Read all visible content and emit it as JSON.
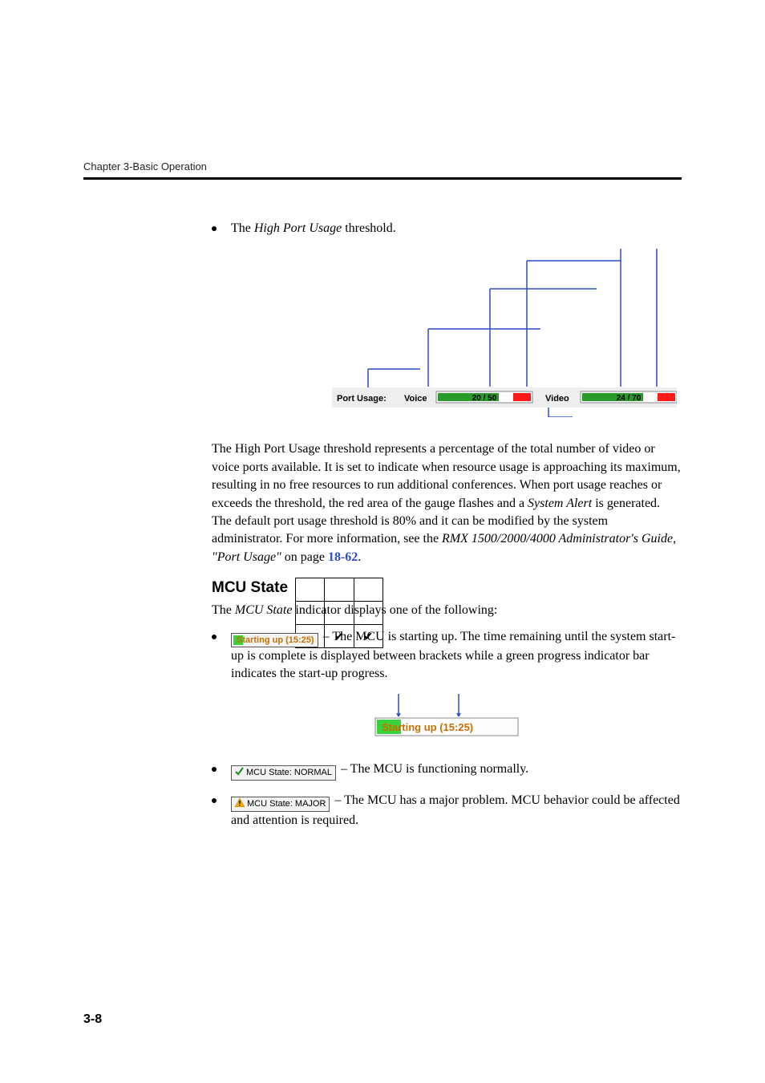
{
  "running_head": "Chapter 3-Basic Operation",
  "bullet_intro_pre": "The ",
  "bullet_intro_em": "High Port Usage",
  "bullet_intro_post": " threshold.",
  "port_usage": {
    "label": "Port Usage:",
    "voice_label": "Voice",
    "video_label": "Video",
    "voice_used": 20,
    "voice_total": 50,
    "video_used": 24,
    "video_total": 70
  },
  "para1_a": "The High Port Usage threshold represents a percentage of the total number of video or voice ports available. It is set to indicate when resource usage is approaching its maximum, resulting in no free resources to run additional conferences. When port usage reaches or exceeds the threshold, the red area of the gauge flashes and a ",
  "para1_em1": "System Alert",
  "para1_b": " is generated. The default port usage threshold is 80% and it can be modified by the system administrator. For more information, see the ",
  "para1_em2": "RMX 1500/2000/4000 Administrator's Guide",
  "para1_c": ", ",
  "para1_em3": "\"Port Usage\"",
  "para1_d": " on page ",
  "para1_link": "18-62",
  "para1_e": ".",
  "h_mcu_state": "MCU State",
  "mcu_intro_a": "The ",
  "mcu_intro_em": "MCU State",
  "mcu_intro_b": " indicator displays one of the following:",
  "badge_starting": "Starting up (15:25)",
  "li1": " – The MCU is starting up. The time remaining until the system start-up is complete is displayed between brackets while a green progress indicator bar indicates the start-up progress.",
  "badge_starting_big": "Starting up (15:25)",
  "badge_normal": "MCU State: NORMAL",
  "li2": " – The MCU is functioning normally.",
  "badge_major": "MCU State: MAJOR",
  "li3": " – The MCU has a major problem. MCU behavior could be affected and attention is required.",
  "page_no": "3-8"
}
